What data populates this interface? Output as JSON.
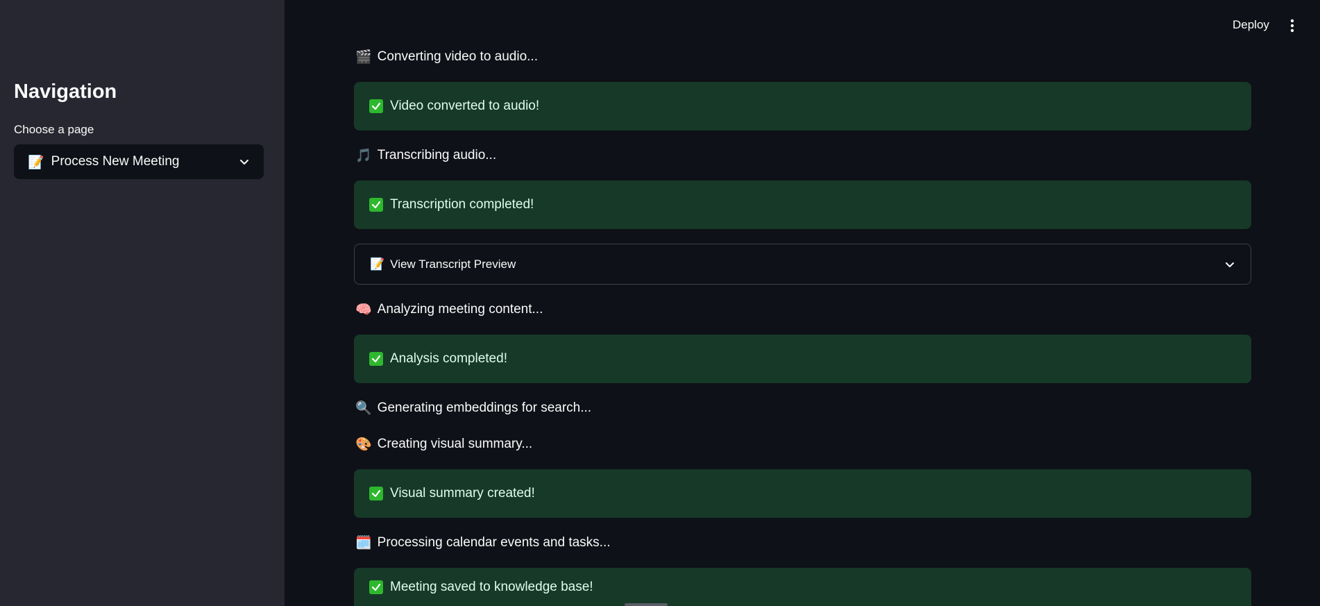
{
  "sidebar": {
    "title": "Navigation",
    "choose_label": "Choose a page",
    "select": {
      "emoji": "📝",
      "value": "Process New Meeting"
    }
  },
  "header": {
    "deploy_label": "Deploy",
    "menu_icon": "vertical-dots-icon"
  },
  "steps": {
    "video": {
      "emoji": "🎬",
      "text": "Converting video to audio..."
    },
    "video_done": {
      "text": "Video converted to audio!"
    },
    "transcribe": {
      "emoji": "🎵",
      "text": "Transcribing audio..."
    },
    "transcribe_done": {
      "text": "Transcription completed!"
    },
    "preview": {
      "emoji": "📝",
      "text": "View Transcript Preview"
    },
    "analyze": {
      "emoji": "🧠",
      "text": "Analyzing meeting content..."
    },
    "analyze_done": {
      "text": "Analysis completed!"
    },
    "embed": {
      "emoji": "🔍",
      "text": "Generating embeddings for search..."
    },
    "visual": {
      "emoji": "🎨",
      "text": "Creating visual summary..."
    },
    "visual_done": {
      "text": "Visual summary created!"
    },
    "calendar": {
      "emoji": "🗓️",
      "text": "Processing calendar events and tasks..."
    },
    "saved": {
      "text": "Meeting saved to knowledge base!"
    }
  },
  "colors": {
    "success_bg": "#173928",
    "success_text": "#dffde9",
    "sidebar_bg": "#262730",
    "main_bg": "#0e1117"
  }
}
